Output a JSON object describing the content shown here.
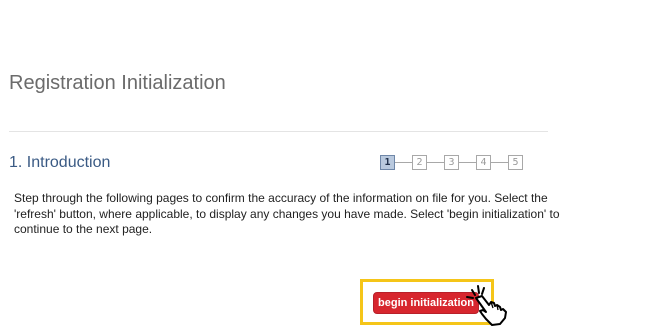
{
  "page": {
    "title": "Registration Initialization"
  },
  "section": {
    "title": "1. Introduction",
    "description": "Step through the following pages to confirm the accuracy of the information on file for you. Select the\n'refresh' button, where applicable, to display any changes you have made.  Select 'begin initialization' to\ncontinue to the next page."
  },
  "stepper": {
    "current_step": 1,
    "steps": [
      "1",
      "2",
      "3",
      "4",
      "5"
    ]
  },
  "actions": {
    "begin_label": "begin initialization"
  },
  "colors": {
    "title_text": "#6b6b6b",
    "section_title": "#3a5a84",
    "button_background": "#d7262e",
    "highlight_border": "#f5c518"
  },
  "icons": {
    "pointer": "hand-pointer-icon"
  }
}
